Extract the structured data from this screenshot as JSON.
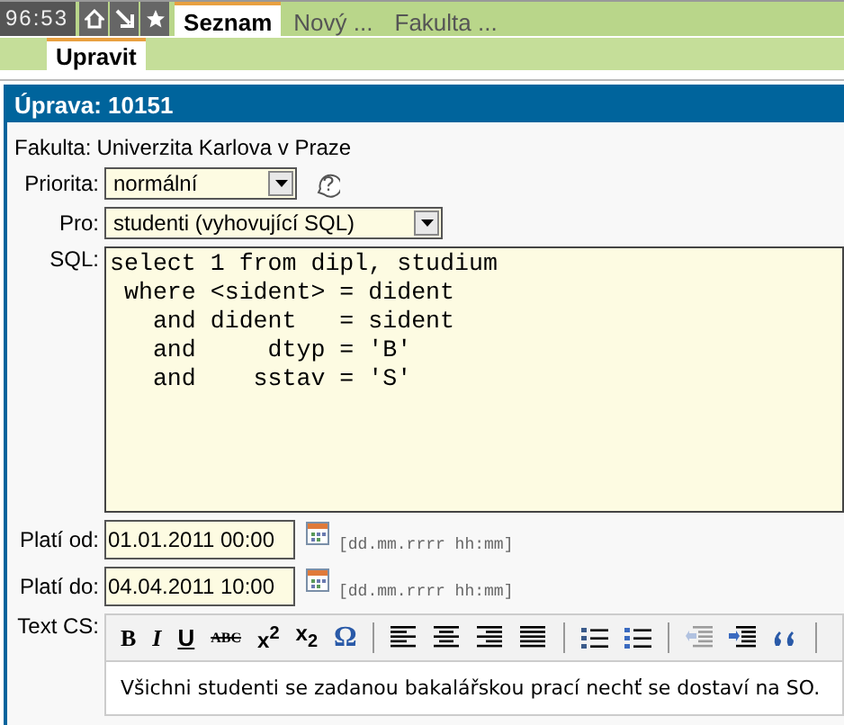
{
  "header": {
    "clock": "96:53"
  },
  "tabs": [
    {
      "label": "Seznam",
      "selected": true
    },
    {
      "label": "Nový ...",
      "selected": false
    },
    {
      "label": "Fakulta ...",
      "selected": false
    }
  ],
  "subtabs": [
    {
      "label": "Upravit",
      "selected": true
    }
  ],
  "panel": {
    "title": "Úprava: 10151"
  },
  "form": {
    "fakulta": {
      "label": "Fakulta:",
      "value": "Univerzita Karlova v Praze"
    },
    "priorita": {
      "label": "Priorita:",
      "value": "normální"
    },
    "pro": {
      "label": "Pro:",
      "value": "studenti (vyhovující SQL)"
    },
    "sql": {
      "label": "SQL:",
      "value": "select 1 from dipl, studium\n where <sident> = dident\n   and dident   = sident\n   and     dtyp = 'B'\n   and    sstav = 'S'"
    },
    "plati_od": {
      "label": "Platí od:",
      "value": "01.01.2011 00:00",
      "hint": "[dd.mm.rrrr hh:mm]"
    },
    "plati_do": {
      "label": "Platí do:",
      "value": "04.04.2011 10:00",
      "hint": "[dd.mm.rrrr hh:mm]"
    },
    "text_cs": {
      "label": "Text CS:",
      "content": "Všichni studenti se zadanou bakalářskou prací nechť se dostaví na SO.",
      "toolbar": [
        {
          "kind": "bold",
          "label": "B",
          "disabled": false
        },
        {
          "kind": "italic",
          "label": "I",
          "disabled": false
        },
        {
          "kind": "underline",
          "label": "U",
          "disabled": false
        },
        {
          "kind": "strike",
          "label": "ABC",
          "disabled": false
        },
        {
          "kind": "sup",
          "label": "x$^{2}$",
          "disabled": false
        },
        {
          "kind": "sub",
          "label": "x$_{2}$",
          "disabled": false
        },
        {
          "kind": "omega",
          "label": "Ω",
          "disabled": false
        },
        {
          "kind": "separator"
        },
        {
          "kind": "align-left",
          "disabled": false
        },
        {
          "kind": "align-center",
          "disabled": false
        },
        {
          "kind": "align-right",
          "disabled": false
        },
        {
          "kind": "justify",
          "disabled": false
        },
        {
          "kind": "separator"
        },
        {
          "kind": "bullets",
          "disabled": false
        },
        {
          "kind": "numbers",
          "disabled": false
        },
        {
          "kind": "separator"
        },
        {
          "kind": "outdent",
          "disabled": true
        },
        {
          "kind": "indent",
          "disabled": false
        },
        {
          "kind": "quote",
          "disabled": false
        },
        {
          "kind": "separator"
        }
      ]
    }
  }
}
